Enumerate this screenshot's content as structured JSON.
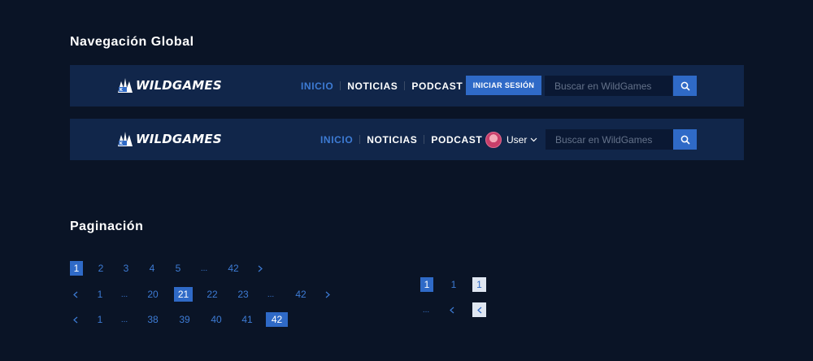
{
  "sections": {
    "nav_title": "Navegación Global",
    "pag_title": "Paginación"
  },
  "brand": {
    "logo_text": "WILDGAMES"
  },
  "nav": {
    "inicio": "INICIO",
    "noticias": "NOTICIAS",
    "podcast": "PODCAST",
    "login": "INICIAR SESIÓN",
    "user": "User",
    "search_placeholder": "Buscar en WildGames"
  },
  "icons": {
    "search": "search-icon",
    "chevron_down": "chevron-down-icon",
    "chevron_left": "chevron-left-icon",
    "chevron_right": "chevron-right-icon"
  },
  "colors": {
    "background": "#0a1426",
    "navbar": "#11264a",
    "accent": "#2f6ac7",
    "link_active": "#3d7bd4"
  },
  "pagination": {
    "row1": [
      "1",
      "2",
      "3",
      "4",
      "5",
      "...",
      "42"
    ],
    "row2": [
      "1",
      "...",
      "20",
      "21",
      "22",
      "23",
      "...",
      "42"
    ],
    "row3": [
      "1",
      "...",
      "38",
      "39",
      "40",
      "41",
      "42"
    ],
    "compact1": [
      "1",
      "1",
      "1"
    ],
    "compact2": [
      "..."
    ]
  }
}
